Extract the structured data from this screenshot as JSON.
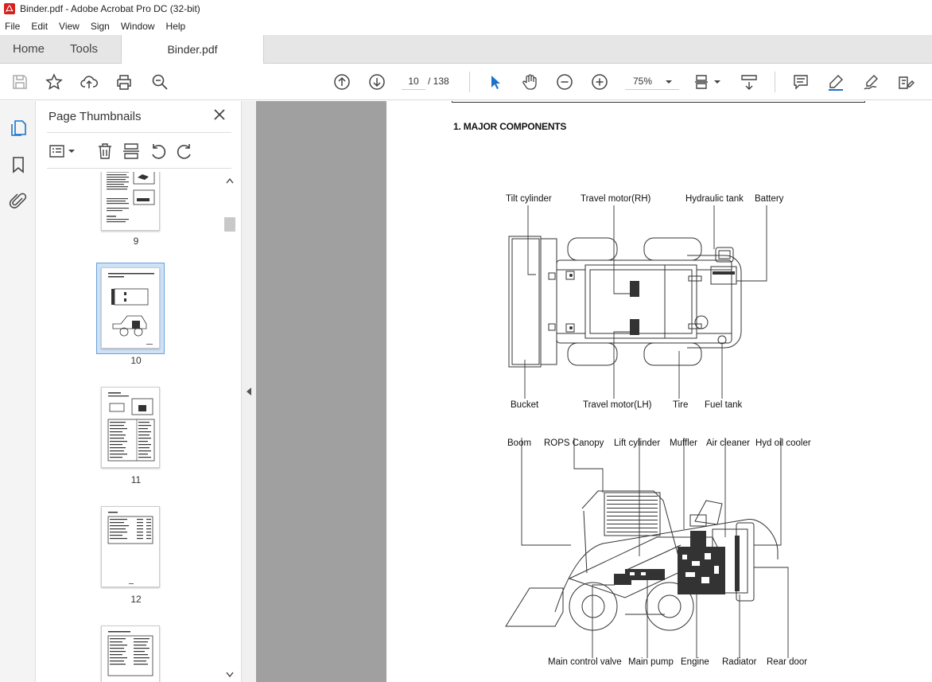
{
  "window": {
    "title": "Binder.pdf - Adobe Acrobat Pro DC (32-bit)"
  },
  "menu": {
    "items": [
      "File",
      "Edit",
      "View",
      "Sign",
      "Window",
      "Help"
    ]
  },
  "tabs": {
    "home": "Home",
    "tools": "Tools",
    "document": "Binder.pdf"
  },
  "toolbar": {
    "page_current": "10",
    "page_total": "/ 138",
    "zoom": "75%"
  },
  "panel": {
    "title": "Page Thumbnails",
    "thumbnails": [
      {
        "label": "9"
      },
      {
        "label": "10",
        "selected": true
      },
      {
        "label": "11"
      },
      {
        "label": "12"
      }
    ]
  },
  "page": {
    "section_title": "1. MAJOR COMPONENTS",
    "top_view_labels": {
      "tilt_cylinder": "Tilt cylinder",
      "travel_motor_rh": "Travel motor(RH)",
      "hydraulic_tank": "Hydraulic tank",
      "battery": "Battery",
      "bucket": "Bucket",
      "travel_motor_lh": "Travel motor(LH)",
      "tire": "Tire",
      "fuel_tank": "Fuel tank"
    },
    "side_view_labels": {
      "boom": "Boom",
      "rops_canopy": "ROPS Canopy",
      "lift_cylinder": "Lift cylinder",
      "muffler": "Muffler",
      "air_cleaner": "Air cleaner",
      "hyd_oil_cooler": "Hyd oil cooler",
      "main_control_valve": "Main control valve",
      "main_pump": "Main pump",
      "engine": "Engine",
      "radiator": "Radiator",
      "rear_door": "Rear door"
    }
  }
}
